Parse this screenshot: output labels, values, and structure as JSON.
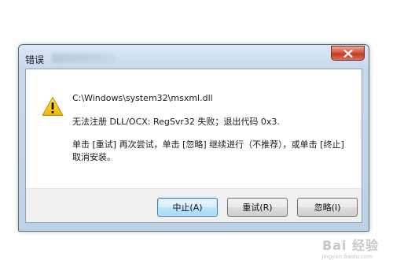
{
  "dialog": {
    "title": "错误",
    "colors": {
      "title_bar": "#c9d9ec",
      "close_button": "#c43a25",
      "default_button_border": "#3c7fb1",
      "warning_icon": "#f2c200"
    }
  },
  "message": {
    "path": "C:\\Windows\\system32\\msxml.dll",
    "error": "无法注册 DLL/OCX: RegSvr32 失败；退出代码 0x3.",
    "instruction": "单击 [重试] 再次尝试，单击 [忽略] 继续进行（不推荐），或单击 [终止] 取消安装。",
    "icon": "warning-icon"
  },
  "buttons": {
    "abort_label": "中止(A)",
    "retry_label": "重试(R)",
    "ignore_label": "忽略(I)",
    "close_icon": "close-icon"
  },
  "watermark": {
    "text": "Bai 经验",
    "subtext": "jingyan.baidu.com"
  }
}
